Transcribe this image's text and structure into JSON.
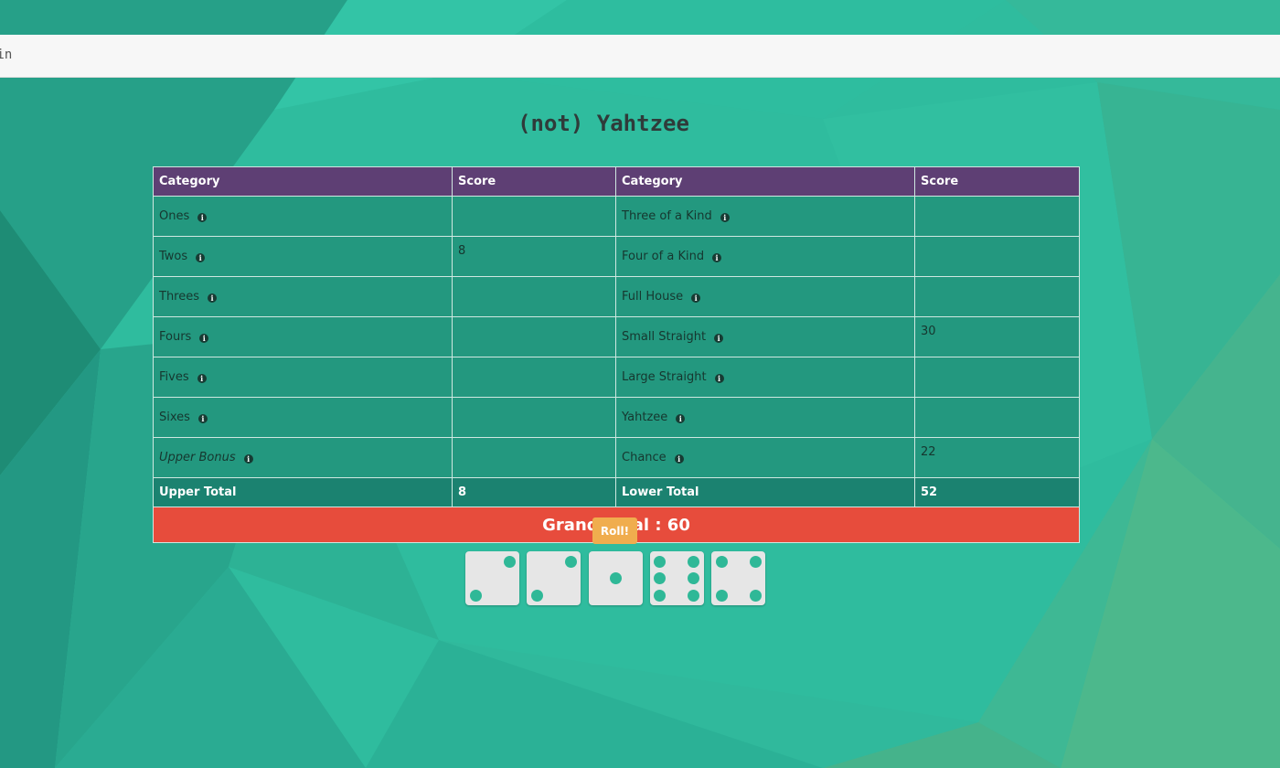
{
  "topbar": {
    "text": "gin"
  },
  "title": "(not) Yahtzee",
  "table": {
    "headers": [
      "Category",
      "Score",
      "Category",
      "Score"
    ],
    "rows": [
      {
        "upper": "Ones",
        "upper_score": "",
        "lower": "Three of a Kind",
        "lower_score": ""
      },
      {
        "upper": "Twos",
        "upper_score": "8",
        "lower": "Four of a Kind",
        "lower_score": ""
      },
      {
        "upper": "Threes",
        "upper_score": "",
        "lower": "Full House",
        "lower_score": ""
      },
      {
        "upper": "Fours",
        "upper_score": "",
        "lower": "Small Straight",
        "lower_score": "30"
      },
      {
        "upper": "Fives",
        "upper_score": "",
        "lower": "Large Straight",
        "lower_score": ""
      },
      {
        "upper": "Sixes",
        "upper_score": "",
        "lower": "Yahtzee",
        "lower_score": ""
      },
      {
        "upper": "Upper Bonus",
        "upper_score": "",
        "lower": "Chance",
        "lower_score": "22"
      }
    ],
    "upper_total_label": "Upper Total",
    "upper_total": "8",
    "lower_total_label": "Lower Total",
    "lower_total": "52",
    "grand_total": "Grand Total : 60"
  },
  "info_icon": "info-icon",
  "roll_label": "Roll!",
  "dice": [
    2,
    2,
    1,
    6,
    4
  ],
  "colors": {
    "header": "#5e3f74",
    "cell": "#23987f",
    "total_row": "#1b8270",
    "grand_total": "#e74c3c",
    "roll_button": "#f0ad4e",
    "pip": "#2fb897"
  }
}
